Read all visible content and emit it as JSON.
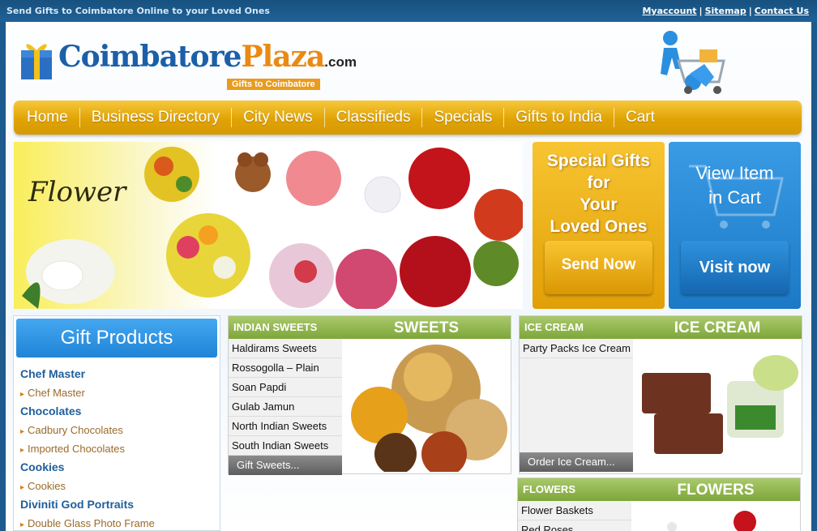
{
  "topbar": {
    "tagline": "Send Gifts to Coimbatore Online to your Loved Ones",
    "links": [
      "Myaccount",
      "Sitemap",
      "Contact Us"
    ],
    "separator": "|"
  },
  "logo": {
    "part1": "Coimbatore",
    "part2": "Plaza",
    "domain": ".com",
    "subtitle": "Gifts to Coimbatore"
  },
  "nav": [
    "Home",
    "Business Directory",
    "City News",
    "Classifieds",
    "Specials",
    "Gifts to India",
    "Cart"
  ],
  "banner": {
    "flower_word": "Flower",
    "special_line1": "Special Gifts",
    "special_line2": "for",
    "special_line3": "Your",
    "special_line4": "Loved Ones",
    "send_button": "Send Now",
    "cart_line1": "View Item",
    "cart_line2": "in Cart",
    "visit_button": "Visit now"
  },
  "sidebar": {
    "title": "Gift Products",
    "entries": [
      {
        "type": "cat",
        "label": "Chef Master"
      },
      {
        "type": "sub",
        "label": "Chef Master"
      },
      {
        "type": "cat",
        "label": "Chocolates"
      },
      {
        "type": "sub",
        "label": "Cadbury Chocolates"
      },
      {
        "type": "sub",
        "label": "Imported Chocolates"
      },
      {
        "type": "cat",
        "label": "Cookies"
      },
      {
        "type": "sub",
        "label": "Cookies"
      },
      {
        "type": "cat",
        "label": "Diviniti God Portraits"
      },
      {
        "type": "sub",
        "label": "Double Glass Photo Frame"
      }
    ]
  },
  "sweets": {
    "head": "INDIAN SWEETS",
    "big": "SWEETS",
    "items": [
      "Haldirams Sweets",
      "Rossogolla – Plain",
      "Soan Papdi",
      "Gulab Jamun",
      "North Indian Sweets",
      "South Indian Sweets"
    ],
    "footer": "Gift Sweets..."
  },
  "icecream": {
    "head": "ICE CREAM",
    "big": "ICE CREAM",
    "items": [
      "Party Packs Ice Cream"
    ],
    "footer": "Order Ice Cream..."
  },
  "flowers": {
    "head": "FLOWERS",
    "big": "FLOWERS",
    "items": [
      "Flower Baskets",
      "Red Roses"
    ]
  },
  "colors": {
    "topbar": "#17517f",
    "nav": "#e1a305",
    "green_header": "#8fb34d",
    "gift_header": "#2d93e2"
  }
}
